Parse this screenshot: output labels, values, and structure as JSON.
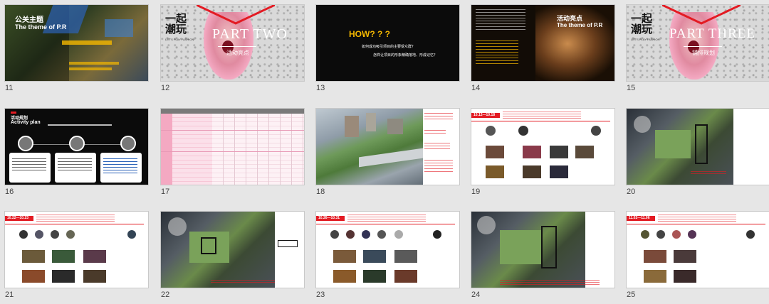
{
  "slides": [
    {
      "num": "11",
      "title": "公关主题",
      "subtitle": "The theme of P.R"
    },
    {
      "num": "12",
      "bigtitle": "PART TWO",
      "caption": "活动亮点",
      "logo_zh": "一起潮玩",
      "logo_en": "LET'S PLAY FASHION"
    },
    {
      "num": "13",
      "heading": "HOW? ? ?",
      "line1": "如何成功吸引项目的主要受众群？",
      "line2": "怎样让项目的形象精确落地、形成记忆？"
    },
    {
      "num": "14",
      "title": "活动亮点",
      "subtitle": "The theme of P.R"
    },
    {
      "num": "15",
      "bigtitle": "PART THREE",
      "caption": "铺排规划",
      "logo_zh": "一起潮玩",
      "logo_en": "LET'S PLAY FASHION"
    },
    {
      "num": "16",
      "title": "活动规划",
      "subtitle": "Activity plan",
      "circles": [
        "",
        "",
        ""
      ]
    },
    {
      "num": "17"
    },
    {
      "num": "18"
    },
    {
      "num": "19",
      "tag": "10.12—10.18"
    },
    {
      "num": "20"
    },
    {
      "num": "21",
      "tag": "10.22—10.23"
    },
    {
      "num": "22"
    },
    {
      "num": "23",
      "tag": "10.26—10.31"
    },
    {
      "num": "24"
    },
    {
      "num": "25",
      "tag": "11.02—11.06"
    }
  ],
  "colors": {
    "accent": "#e31b23",
    "pink": "#f4a9c2",
    "gold": "#f5b800"
  }
}
